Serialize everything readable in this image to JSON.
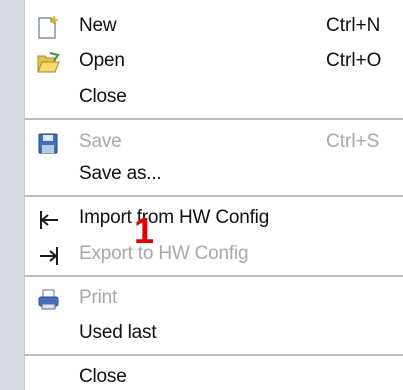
{
  "menu": {
    "items": [
      {
        "id": "new",
        "label": "New",
        "shortcut": "Ctrl+N",
        "enabled": true,
        "icon": "new-document-icon"
      },
      {
        "id": "open",
        "label": "Open",
        "shortcut": "Ctrl+O",
        "enabled": true,
        "icon": "open-folder-icon"
      },
      {
        "id": "close",
        "label": "Close",
        "shortcut": "",
        "enabled": true,
        "icon": ""
      },
      {
        "id": "save",
        "label": "Save",
        "shortcut": "Ctrl+S",
        "enabled": false,
        "icon": "floppy-disk-icon"
      },
      {
        "id": "save-as",
        "label": "Save as...",
        "shortcut": "",
        "enabled": true,
        "icon": ""
      },
      {
        "id": "import-hw",
        "label": "Import from HW Config",
        "shortcut": "",
        "enabled": true,
        "icon": "import-arrow-icon"
      },
      {
        "id": "export-hw",
        "label": "Export to HW Config",
        "shortcut": "",
        "enabled": false,
        "icon": "export-arrow-icon"
      },
      {
        "id": "print",
        "label": "Print",
        "shortcut": "",
        "enabled": false,
        "icon": "printer-icon"
      },
      {
        "id": "used-last",
        "label": "Used last",
        "shortcut": "",
        "enabled": true,
        "icon": ""
      },
      {
        "id": "close-bottom",
        "label": "Close",
        "shortcut": "",
        "enabled": true,
        "icon": ""
      }
    ]
  },
  "annotation": {
    "marker": "1",
    "color": "#e00000"
  },
  "colors": {
    "gutter": "#d8dde4",
    "disabled_text": "#a8a8a8",
    "separator": "#b9bec5"
  }
}
